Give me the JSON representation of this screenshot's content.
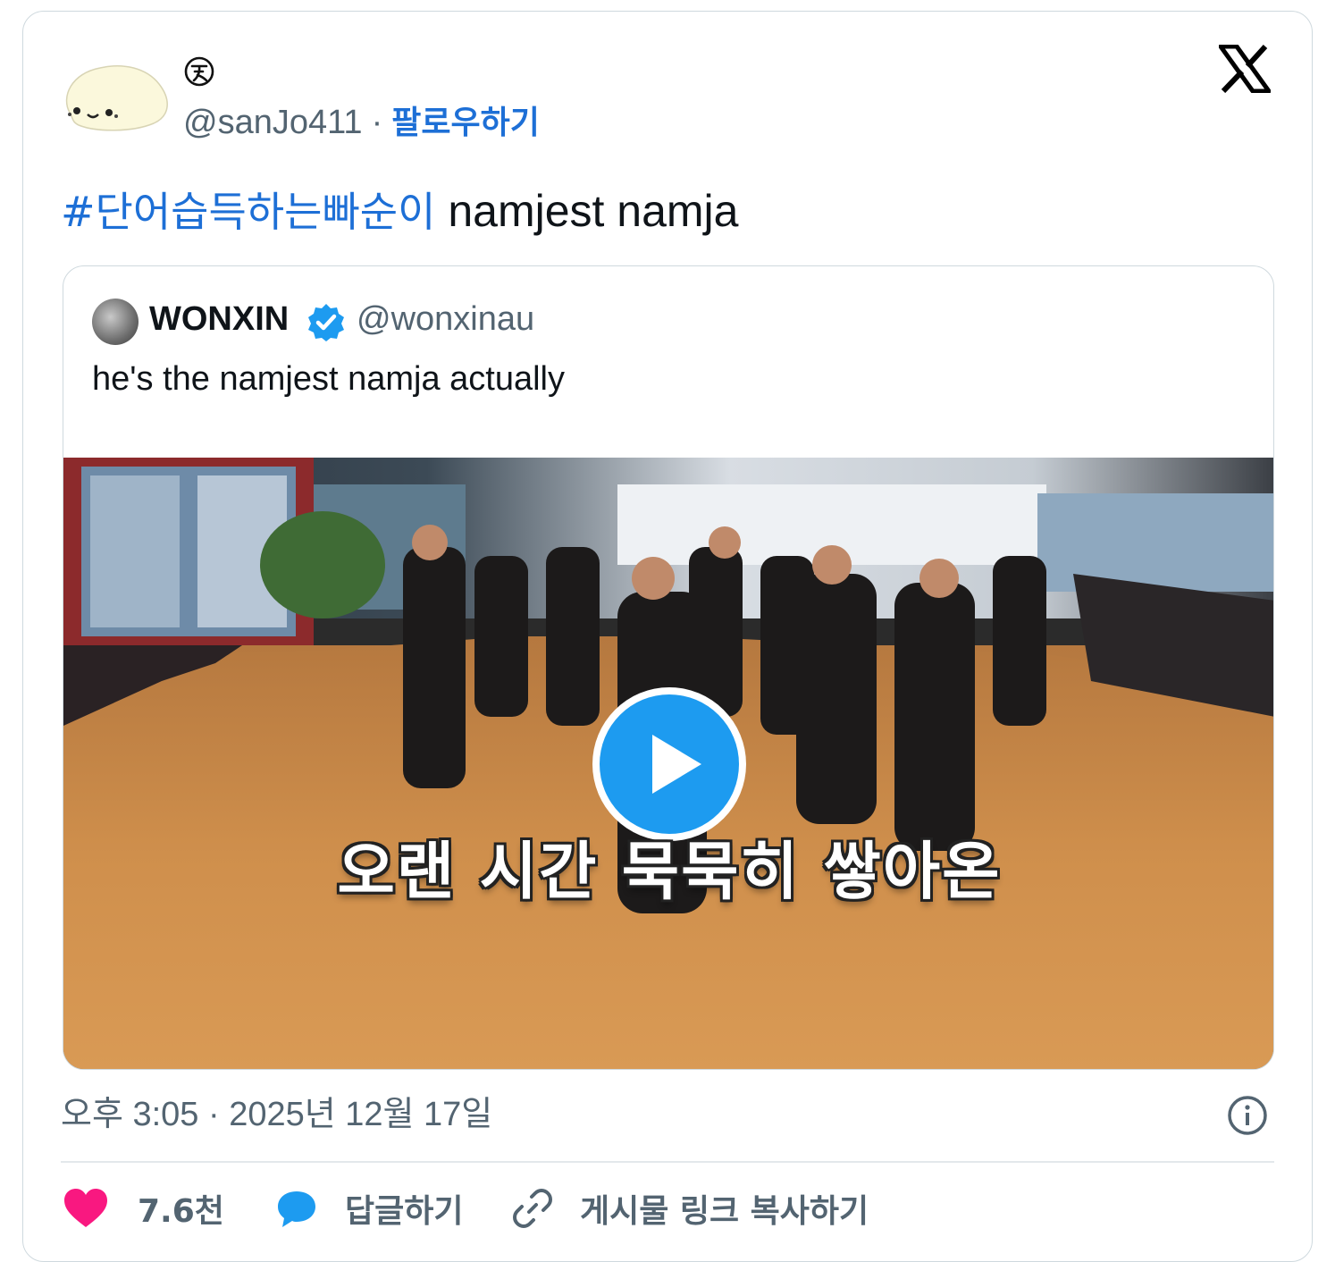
{
  "author": {
    "handle": "@sanJo411",
    "separator": "·",
    "follow_label": "팔로우하기"
  },
  "tweet": {
    "hashtag": "#단어습득하는빠순이",
    "text": " namjest namja"
  },
  "quote": {
    "name": "WONXIN",
    "handle": "@wonxinau",
    "text": "he's the namjest namja actually",
    "video_subtitle": "오랜 시간 묵묵히 쌓아온"
  },
  "meta": {
    "timestamp": "오후 3:05 · 2025년 12월 17일"
  },
  "actions": {
    "likes_count": "7.6천",
    "reply_label": "답글하기",
    "copy_link_label": "게시물 링크 복사하기"
  },
  "icons": {
    "platform": "x-logo-icon",
    "like": "heart-icon",
    "reply": "speech-bubble-icon",
    "copy": "link-icon",
    "info": "info-icon",
    "play": "play-icon",
    "verified": "verified-badge-icon"
  },
  "colors": {
    "link": "#1d6fd6",
    "like": "#f91880",
    "reply": "#1d9bf0",
    "play": "#1d9bf0",
    "muted": "#536471"
  }
}
